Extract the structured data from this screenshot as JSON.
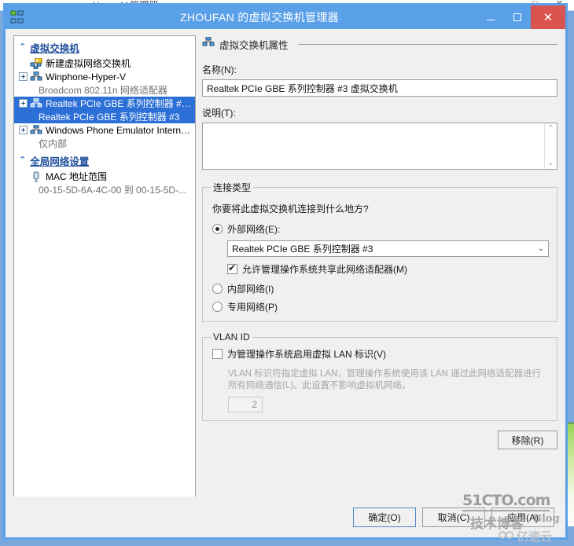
{
  "background_window": {
    "title": "Hyper-V 管理器",
    "buttons": "─ □ ✕"
  },
  "window": {
    "title": "ZHOUFAN 的虚拟交换机管理器",
    "icon": "virtual-switch-icon",
    "minimize_glyph": "─",
    "maximize_glyph": "□",
    "close_glyph": "✕"
  },
  "tree": {
    "groups": [
      {
        "label": "虚拟交换机",
        "chevron": "⌃",
        "items": [
          {
            "label": "新建虚拟网络交换机",
            "icon": "new-virtual-switch-icon",
            "expandable": false,
            "indent": 1,
            "selected": false,
            "sub": null
          },
          {
            "label": "Winphone-Hyper-V",
            "icon": "virtual-switch-icon",
            "expandable": true,
            "indent": 0,
            "selected": false,
            "sub": "Broadcom 802.11n 网络适配器"
          },
          {
            "label": "Realtek PCIe GBE 系列控制器 #3 ...",
            "icon": "virtual-switch-icon",
            "expandable": true,
            "indent": 0,
            "selected": true,
            "sub": "Realtek PCIe GBE 系列控制器 #3"
          },
          {
            "label": "Windows Phone Emulator Internal ...",
            "icon": "virtual-switch-icon",
            "expandable": true,
            "indent": 0,
            "selected": false,
            "sub": "仅内部"
          }
        ]
      },
      {
        "label": "全局网络设置",
        "chevron": "⌃",
        "items": [
          {
            "label": "MAC 地址范围",
            "icon": "mac-address-icon",
            "expandable": false,
            "indent": 1,
            "selected": false,
            "sub": "00-15-5D-6A-4C-00 到 00-15-5D-..."
          }
        ]
      }
    ]
  },
  "detail": {
    "section_title": "虚拟交换机属性",
    "name_label": "名称(N):",
    "name_value": "Realtek PCIe GBE 系列控制器 #3 虚拟交换机",
    "description_label": "说明(T):",
    "description_value": "",
    "scroll_up": "⌃",
    "scroll_down": "⌄",
    "connection_type": {
      "legend": "连接类型",
      "question": "你要将此虚拟交换机连接到什么地方?",
      "options": [
        {
          "label": "外部网络(E):",
          "selected": true
        },
        {
          "label": "内部网络(I)",
          "selected": false
        },
        {
          "label": "专用网络(P)",
          "selected": false
        }
      ],
      "adapter_value": "Realtek PCIe GBE 系列控制器 #3",
      "adapter_arrow": "⌄",
      "share_checkbox": {
        "label": "允许管理操作系统共享此网络适配器(M)",
        "checked": true
      }
    },
    "vlan": {
      "legend": "VLAN ID",
      "enable_checkbox": {
        "label": "为管理操作系统启用虚拟 LAN 标识(V)",
        "checked": false
      },
      "hint": "VLAN 标识符指定虚拟 LAN，管理操作系统使用该 LAN 通过此网络适配器进行所有网络通信(L)。此设置不影响虚拟机网络。",
      "id_value": "2"
    },
    "remove_button": "移除(R)"
  },
  "footer": {
    "ok": "确定(O)",
    "cancel": "取消(C)",
    "apply": "应用(A)"
  },
  "watermarks": {
    "site": "51CTO",
    "site_suffix": ".com",
    "tech": "技术博客",
    "blog": "Blog",
    "cloud": "亿速云",
    "cloud_icon": "cloud-logo-icon"
  },
  "colors": {
    "titlebar": "#5aa0e8",
    "close_button": "#d9534f",
    "selection": "#2c6fd6",
    "group_header": "#1f4e9c",
    "dialog_bg": "#f0f0f0"
  }
}
